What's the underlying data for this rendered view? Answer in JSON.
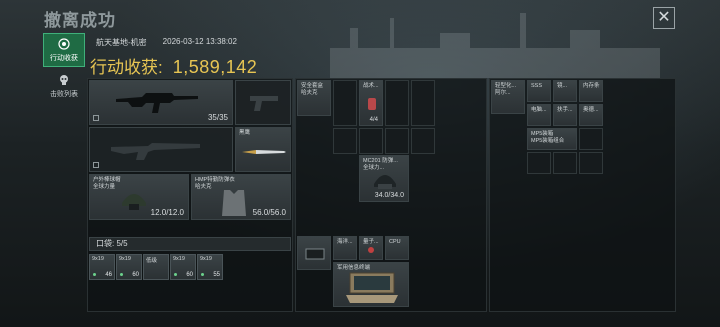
{
  "header": {
    "title": "撤离成功",
    "close_glyph": "✕"
  },
  "sidebar": {
    "tabs": [
      {
        "label": "行动收获",
        "icon": "target-icon",
        "active": true
      },
      {
        "label": "击败列表",
        "icon": "skull-icon",
        "active": false
      }
    ]
  },
  "session": {
    "map_name": "航天基地-机密",
    "timestamp": "2026-03-12 13:38:02"
  },
  "earnings": {
    "label": "行动收获:",
    "value": "1,589,142"
  },
  "loadout": {
    "primary_weapon": {
      "durability": "35/35"
    },
    "melee": {
      "label": "黑鹰"
    },
    "helmet": {
      "label1": "户外棒球帽",
      "label2": "全球力量",
      "durability": "12.0/12.0"
    },
    "armor": {
      "label1": "HMP特勤防弹衣",
      "label2": "哈夫克",
      "durability": "56.0/56.0"
    },
    "pocket_label": "口袋: 5/5",
    "ammo": [
      {
        "caliber": "9x19",
        "count": "46"
      },
      {
        "caliber": "9x19",
        "count": "60"
      },
      {
        "caliber": "低级",
        "count": ""
      },
      {
        "caliber": "9x19",
        "count": "60"
      },
      {
        "caliber": "9x19",
        "count": "55"
      }
    ]
  },
  "chest_rig": {
    "items": [
      {
        "label1": "安全套盒",
        "label2": "哈夫克"
      },
      {
        "label1": "战术...",
        "label2": "",
        "count": "4/4"
      }
    ]
  },
  "backpack": {
    "helmet": {
      "label1": "MC201 防弹...",
      "label2": "全球力...",
      "durability": "34.0/34.0"
    },
    "items": [
      {
        "label": "海洋..."
      },
      {
        "label": "量子..."
      },
      {
        "label": "CPU"
      },
      {
        "label": "军用信息终端"
      }
    ]
  },
  "safe_box": {
    "items": [
      {
        "label1": "轻型化...",
        "label2": "阿尔..."
      },
      {
        "label": "SSS"
      },
      {
        "label": "电脑..."
      },
      {
        "label": "内存条"
      },
      {
        "label": "镜...",
        "label_b": "阿尔..."
      },
      {
        "label": "扶手..."
      },
      {
        "label": "奥德..."
      },
      {
        "label1": "MP5装箱",
        "label2": "MP5装箱组合"
      }
    ]
  }
}
